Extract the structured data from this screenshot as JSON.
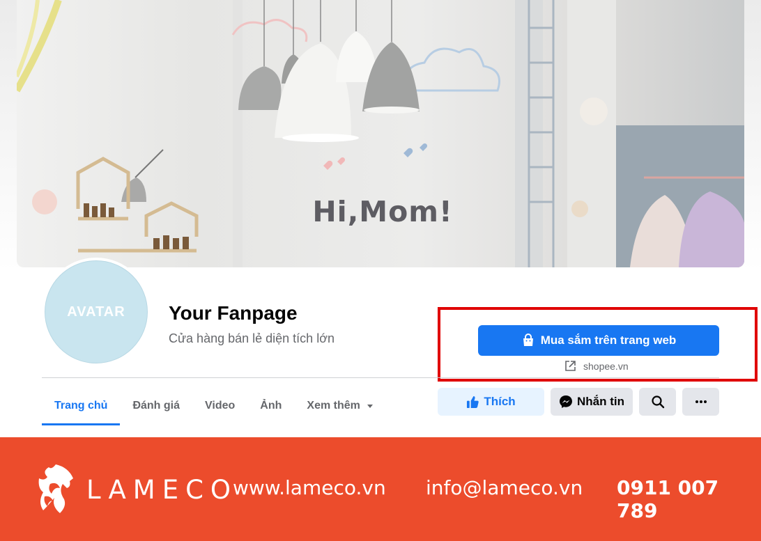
{
  "cover": {
    "slogan": "Hi,Mom!"
  },
  "profile": {
    "avatar_text": "AVATAR",
    "name": "Your Fanpage",
    "category": "Cửa hàng bán lẻ diện tích lớn"
  },
  "shop": {
    "button_label": "Mua sắm trên trang web",
    "link_text": "shopee.vn"
  },
  "tabs": [
    {
      "label": "Trang chủ",
      "active": true
    },
    {
      "label": "Đánh giá"
    },
    {
      "label": "Video"
    },
    {
      "label": "Ảnh"
    },
    {
      "label": "Xem thêm"
    }
  ],
  "actions": {
    "like_label": "Thích",
    "message_label": "Nhắn tin"
  },
  "icons": {
    "shop": "shopping-bag-icon",
    "external": "external-link-icon",
    "like": "thumbs-up-icon",
    "message": "messenger-icon",
    "search": "search-icon",
    "more": "ellipsis-icon",
    "tab_more": "caret-down-icon"
  },
  "colors": {
    "accent": "#1877f2",
    "highlight": "#e00000",
    "footer": "#ec4c2c"
  },
  "footer": {
    "brand": "LAMECO",
    "website": "www.lameco.vn",
    "email": "info@lameco.vn",
    "phone": "0911 007 789"
  }
}
